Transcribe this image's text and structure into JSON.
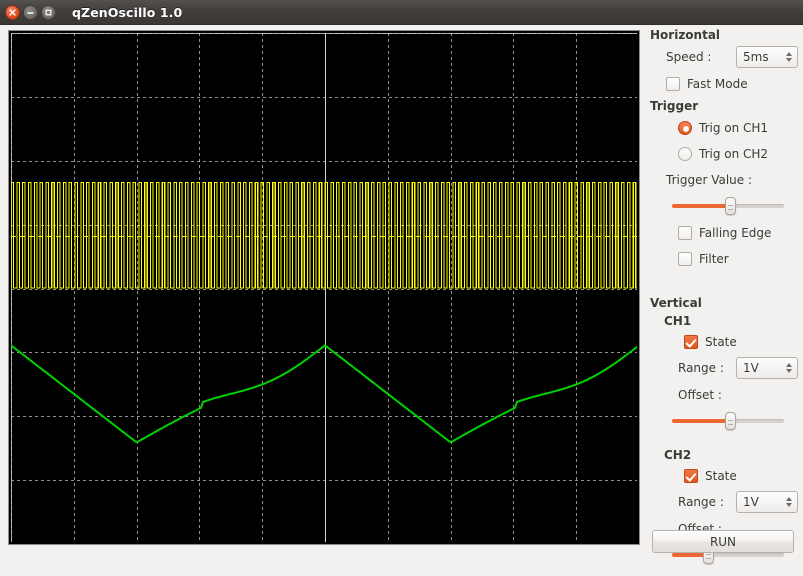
{
  "window": {
    "title": "qZenOscillo 1.0",
    "close_icon": "close-icon",
    "minimize_icon": "minimize-icon",
    "maximize_icon": "maximize-icon"
  },
  "panel": {
    "horizontal": {
      "title": "Horizontal",
      "speed_label": "Speed :",
      "speed_value": "5ms",
      "fast_mode_label": "Fast Mode",
      "fast_mode_checked": false
    },
    "trigger": {
      "title": "Trigger",
      "trig_ch1_label": "Trig on CH1",
      "trig_ch1_selected": true,
      "trig_ch2_label": "Trig on CH2",
      "trig_ch2_selected": false,
      "trigger_value_label": "Trigger Value :",
      "trigger_value_percent": 52,
      "falling_edge_label": "Falling Edge",
      "falling_edge_checked": false,
      "filter_label": "Filter",
      "filter_checked": false
    },
    "vertical": {
      "title": "Vertical",
      "ch1": {
        "title": "CH1",
        "state_label": "State",
        "state_checked": true,
        "range_label": "Range :",
        "range_value": "1V",
        "offset_label": "Offset :",
        "offset_percent": 52
      },
      "ch2": {
        "title": "CH2",
        "state_label": "State",
        "state_checked": true,
        "range_label": "Range :",
        "range_value": "1V",
        "offset_label": "Offset :",
        "offset_percent": 31
      }
    },
    "run_label": "RUN"
  },
  "chart_data": {
    "type": "line",
    "title": "",
    "xlabel": "",
    "ylabel": "",
    "background": "#000000",
    "grid": {
      "on": true,
      "color": "#c8c8c8",
      "style": "dashed",
      "x_divisions": 10,
      "y_divisions": 8,
      "center_axis_solid": true
    },
    "axis_ranges": {
      "x_divisions": 10,
      "y_divisions": 8
    },
    "legend": {
      "position": "none"
    },
    "series": [
      {
        "name": "CH1",
        "color": "#ffff00",
        "type": "square",
        "description": "High-frequency aliased square wave, clipped band",
        "top_div": 2.35,
        "bottom_div": 4.0,
        "mid_level_div": 3.18,
        "cycles_visible": 108,
        "duty": 0.5
      },
      {
        "name": "CH2",
        "color": "#00d200",
        "type": "triangle-noisy",
        "description": "Noisy triangular / rounded waveform, about 2 cycles across the screen",
        "peak_div": 4.88,
        "trough_div": 6.4,
        "period_divisions": 5.0,
        "phase_offset_divisions": 0.0
      }
    ],
    "markers": [
      {
        "name": "trigger-level",
        "color": "#ffff00",
        "style": "dashed",
        "orientation": "horizontal",
        "y_div": 3.18
      }
    ]
  }
}
